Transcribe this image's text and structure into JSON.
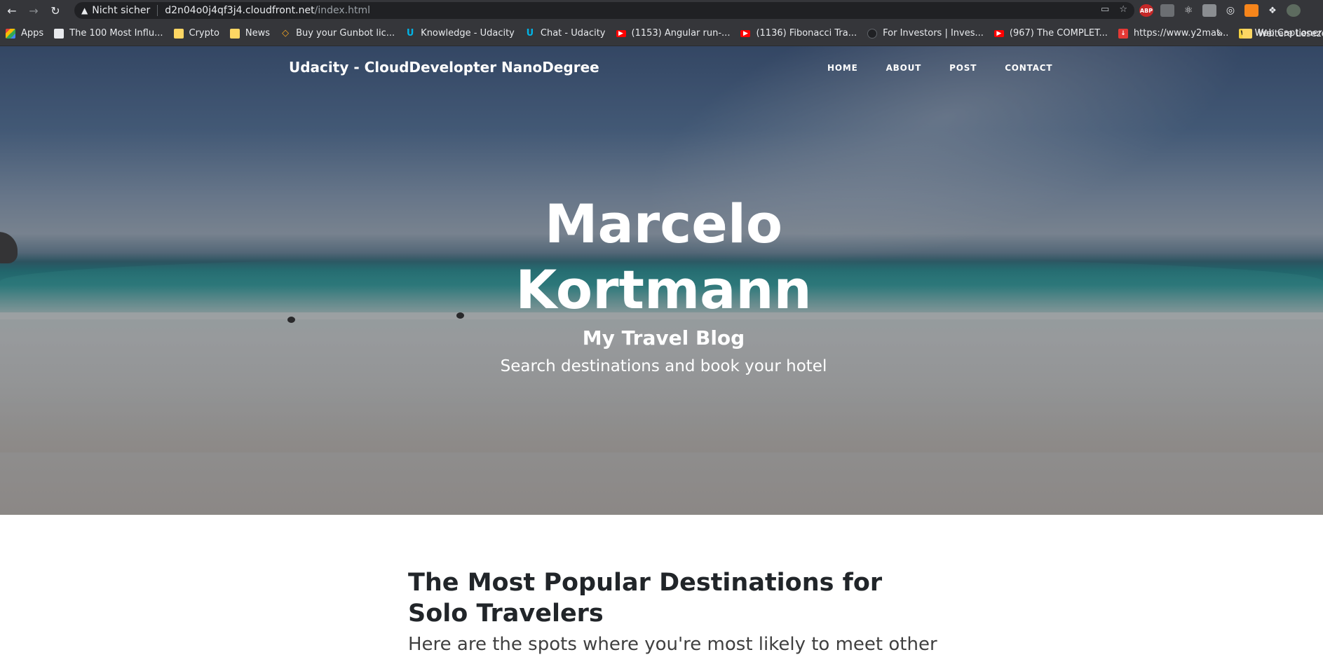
{
  "browser": {
    "security_text": "Nicht sicher",
    "url_host": "d2n04o0j4qf3j4.cloudfront.net",
    "url_path": "/index.html",
    "bookmarks": [
      {
        "label": "Apps",
        "icon": "apps-grid-icon",
        "color": "#ea4335"
      },
      {
        "label": "The 100 Most Influ...",
        "icon": "page-icon",
        "color": "#e8eaed"
      },
      {
        "label": "Crypto",
        "icon": "folder-icon",
        "color": "#fdd663"
      },
      {
        "label": "News",
        "icon": "folder-icon",
        "color": "#fdd663"
      },
      {
        "label": "Buy your Gunbot lic...",
        "icon": "gunbot-icon",
        "color": "#f5a623"
      },
      {
        "label": "Knowledge - Udacity",
        "icon": "udacity-icon",
        "color": "#02b3e4"
      },
      {
        "label": "Chat - Udacity",
        "icon": "udacity-icon",
        "color": "#02b3e4"
      },
      {
        "label": "(1153) Angular run-...",
        "icon": "youtube-icon",
        "color": "#ff0000"
      },
      {
        "label": "(1136) Fibonacci Tra...",
        "icon": "youtube-icon",
        "color": "#ff0000"
      },
      {
        "label": "For Investors | Inves...",
        "icon": "investors-icon",
        "color": "#202124"
      },
      {
        "label": "(967) The COMPLET...",
        "icon": "youtube-icon",
        "color": "#ff0000"
      },
      {
        "label": "https://www.y2mat...",
        "icon": "download-icon",
        "color": "#e53935"
      },
      {
        "label": "Web Captioner",
        "icon": "web-captioner-icon",
        "color": "#f4d03f"
      }
    ],
    "more_bookmarks": "»",
    "other_bookmarks": "Weitere Lesezeichen"
  },
  "site": {
    "brand": "Udacity - CloudDevelopter NanoDegree",
    "nav": {
      "home": "HOME",
      "about": "ABOUT",
      "post": "POST",
      "contact": "CONTACT"
    },
    "hero": {
      "title_line1": "Marcelo",
      "title_line2": "Kortmann",
      "subheading": "My Travel Blog",
      "tagline": "Search destinations and book your hotel"
    },
    "post": {
      "title": "The Most Popular Destinations for Solo Travelers",
      "subtitle": "Here are the spots where you're most likely to meet other"
    }
  }
}
